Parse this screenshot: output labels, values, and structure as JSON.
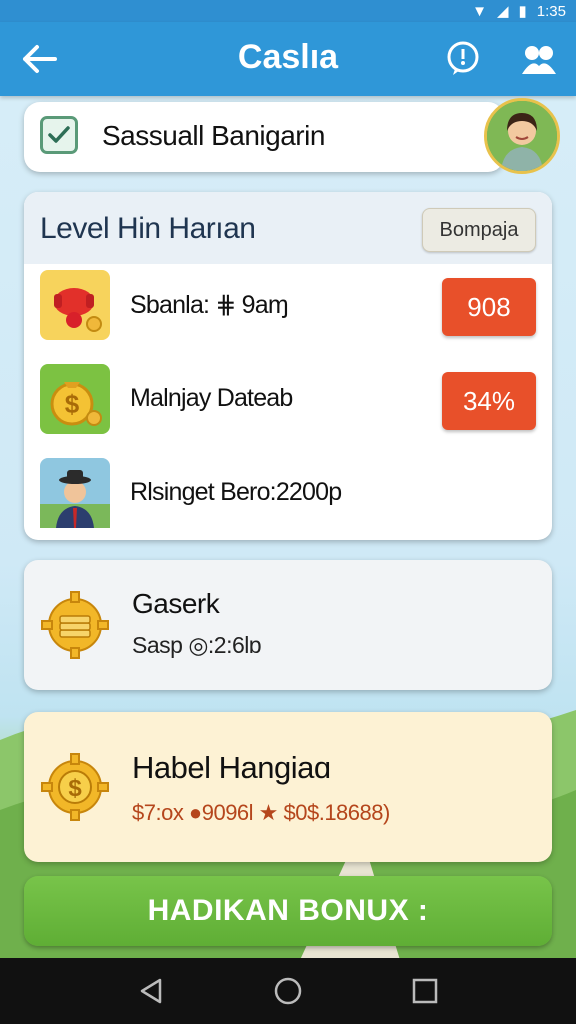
{
  "status": {
    "time": "1:35"
  },
  "app_bar": {
    "title": "Caslıa",
    "back_icon": "back-arrow-icon",
    "info_icon": "alert-icon",
    "profile_icon": "group-icon"
  },
  "search": {
    "value": "Sassuall Banigarin"
  },
  "level": {
    "title": "Level Hin Harıan",
    "button_label": "Bomрaja",
    "rows": [
      {
        "label": "Sbanla: ⋕ 9aɱ",
        "badge": "908",
        "icon": "red-piggy-icon"
      },
      {
        "label": "Malnjay Dateab",
        "badge": "34%",
        "icon": "coin-bag-icon"
      },
      {
        "label": "Rlsinget Bero:2200р",
        "badge": "",
        "icon": "person-avatar-icon"
      }
    ]
  },
  "caserk": {
    "title": "Gaserk",
    "subtitle": "Sasp ◎:2:6lɒ",
    "icon": "coin-stack-gear-icon"
  },
  "bonus": {
    "title": "Habel Hangiaɑ",
    "subtitle": "$7:ox ●9096l ★ $0$.18688)",
    "icon": "dollar-gear-icon"
  },
  "cta": {
    "label": "HADIKAN BONUX :"
  },
  "colors": {
    "primary": "#2f97d8",
    "badge": "#e8502a",
    "cta": "#6bb83f",
    "bonus_bg": "#fdf2d4"
  }
}
